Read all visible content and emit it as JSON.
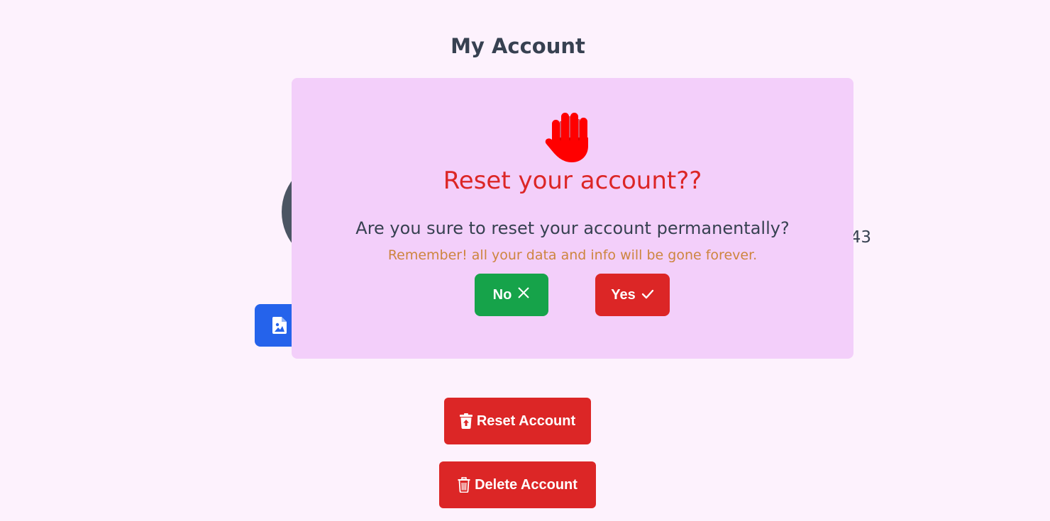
{
  "page": {
    "title": "My Account",
    "account_value_partial": "43",
    "upload_icon": "image-file-icon"
  },
  "actions": {
    "reset_label": "Reset Account",
    "reset_icon": "trash-restore-icon",
    "delete_label": "Delete Account",
    "delete_icon": "trash-icon"
  },
  "modal": {
    "icon": "raised-hand-icon",
    "title": "Reset your account??",
    "question": "Are you sure to reset your account permanentally?",
    "warning": "Remember! all your data and info will be gone forever.",
    "no_label": "No",
    "no_icon": "close-icon",
    "yes_label": "Yes",
    "yes_icon": "check-icon"
  },
  "colors": {
    "background": "#fdf2fd",
    "modal_background": "#f3cffa",
    "danger": "#dc2626",
    "success": "#16a34a",
    "primary": "#2563eb",
    "warning_text": "#cd853f",
    "hand": "#ff0000"
  }
}
